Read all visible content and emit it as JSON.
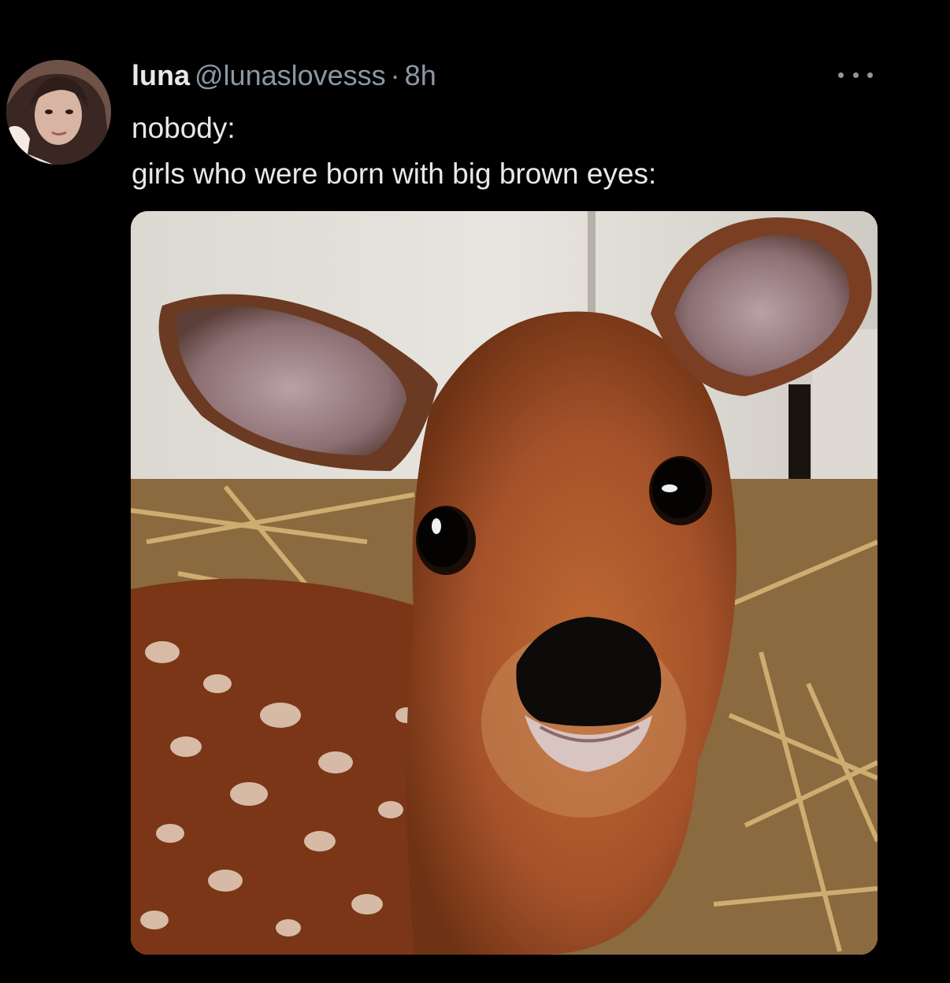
{
  "tweet": {
    "display_name": "luna",
    "handle": "@lunaslovesss",
    "separator": "·",
    "time": "8h",
    "text_lines": [
      "nobody:",
      "girls who were born with big brown eyes:"
    ]
  },
  "icons": {
    "more": "more-horizontal-icon"
  },
  "colors": {
    "background": "#000000",
    "primary_text": "#e7e9ea",
    "secondary_text": "#8b98a5"
  }
}
